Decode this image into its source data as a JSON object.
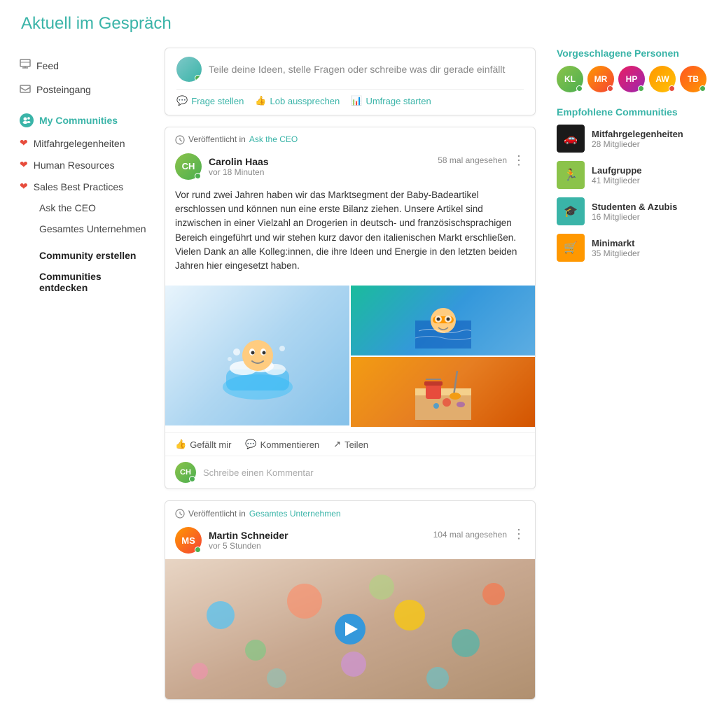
{
  "header": {
    "title": "Aktuell im Gespräch"
  },
  "sidebar": {
    "items": [
      {
        "id": "feed",
        "label": "Feed",
        "icon": "feed-icon",
        "type": "regular"
      },
      {
        "id": "posteingang",
        "label": "Posteingang",
        "icon": "inbox-icon",
        "type": "regular"
      }
    ],
    "my_communities_label": "My Communities",
    "favorites": [
      {
        "id": "mitfahrgelegenheiten",
        "label": "Mitfahrgelegenheiten"
      },
      {
        "id": "human-resources",
        "label": "Human Resources"
      },
      {
        "id": "sales-best-practices",
        "label": "Sales Best Practices"
      }
    ],
    "other_items": [
      {
        "id": "ask-the-ceo",
        "label": "Ask the CEO"
      },
      {
        "id": "gesamtes-unternehmen",
        "label": "Gesamtes Unternehmen"
      }
    ],
    "actions": [
      {
        "id": "community-erstellen",
        "label": "Community erstellen"
      },
      {
        "id": "communities-entdecken",
        "label": "Communities entdecken"
      }
    ]
  },
  "composer": {
    "placeholder": "Teile deine Ideen, stelle Fragen oder schreibe was dir gerade einfällt",
    "actions": [
      {
        "id": "frage",
        "label": "Frage stellen"
      },
      {
        "id": "lob",
        "label": "Lob aussprechen"
      },
      {
        "id": "umfrage",
        "label": "Umfrage starten"
      }
    ]
  },
  "posts": [
    {
      "id": "post1",
      "published_in_label": "Veröffentlicht in",
      "community": "Ask the CEO",
      "author": "Carolin Haas",
      "time": "vor 18 Minuten",
      "views": "58 mal angesehen",
      "body": "Vor rund zwei Jahren haben wir das Marktsegment der Baby-Badeartikel erschlossen und können nun eine erste Bilanz ziehen. Unsere Artikel sind inzwischen in einer Vielzahl an Drogerien in deutsch- und französischsprachigen Bereich eingeführt und wir stehen kurz davor den italienischen Markt erschließen. Vielen Dank an alle Kolleg:innen, die ihre Ideen und Energie in den letzten beiden Jahren hier eingesetzt haben.",
      "actions": [
        {
          "id": "like",
          "label": "Gefällt mir"
        },
        {
          "id": "comment",
          "label": "Kommentieren"
        },
        {
          "id": "share",
          "label": "Teilen"
        }
      ],
      "comment_placeholder": "Schreibe einen Kommentar"
    },
    {
      "id": "post2",
      "published_in_label": "Veröffentlicht in",
      "community": "Gesamtes Unternehmen",
      "author": "Martin Schneider",
      "time": "vor 5 Stunden",
      "views": "104 mal angesehen"
    }
  ],
  "right_sidebar": {
    "suggested_persons_title": "Vorgeschlagene Personen",
    "suggested_persons": [
      {
        "id": "p1",
        "initials": "KL",
        "color": "av1",
        "online": true
      },
      {
        "id": "p2",
        "initials": "MR",
        "color": "av2",
        "online": false
      },
      {
        "id": "p3",
        "initials": "HP",
        "color": "av3",
        "online": true
      },
      {
        "id": "p4",
        "initials": "AW",
        "color": "av4",
        "online": false
      },
      {
        "id": "p5",
        "initials": "TB",
        "color": "av5",
        "online": true
      }
    ],
    "recommended_communities_title": "Empfohlene Communities",
    "communities": [
      {
        "id": "mitfahrgelegenheiten",
        "name": "Mitfahrgelegenheiten",
        "members": "28 Mitglieder",
        "color": "ct1",
        "icon": "🚗"
      },
      {
        "id": "laufgruppe",
        "name": "Laufgruppe",
        "members": "41 Mitglieder",
        "color": "ct2",
        "icon": "🏃"
      },
      {
        "id": "studenten-azubis",
        "name": "Studenten & Azubis",
        "members": "16 Mitglieder",
        "color": "ct3",
        "icon": "🎓"
      },
      {
        "id": "minimarkt",
        "name": "Minimarkt",
        "members": "35 Mitglieder",
        "color": "ct4",
        "icon": "🛒"
      }
    ]
  }
}
